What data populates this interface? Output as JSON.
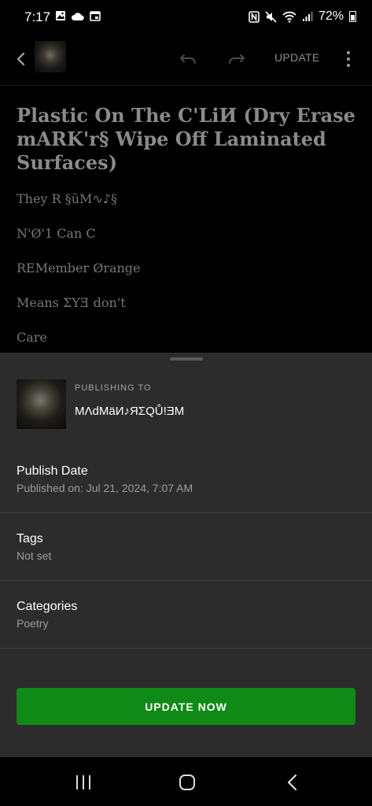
{
  "status_bar": {
    "time": "7:17",
    "battery": "72%",
    "left_icons": [
      "image-icon",
      "cloud-icon",
      "calendar-icon"
    ],
    "right_icons": [
      "nfc-icon",
      "mute-icon",
      "wifi-icon",
      "signal-icon",
      "battery-icon"
    ]
  },
  "app_bar": {
    "update_label": "UPDATE",
    "icons": [
      "back-icon",
      "undo-icon",
      "redo-icon",
      "more-vert-icon"
    ]
  },
  "post": {
    "title": "Plastic On The C'LiИ (Dry Erase mARK'r§ Wipe Off Laminated Surfaces)",
    "lines": [
      "They R §üM∿♪§",
      "N'Ø'1 Can C",
      "REMember Ørange",
      "Means ΣYƎ don't",
      "Care"
    ]
  },
  "sheet": {
    "publishing_to_label": "PUBLISHING TO",
    "site_name": "MΛdMäИ♪ЯΣQŮ!ƎM",
    "publish_date": {
      "title": "Publish Date",
      "value": "Published on: Jul 21, 2024, 7:07 AM"
    },
    "tags": {
      "title": "Tags",
      "value": "Not set"
    },
    "categories": {
      "title": "Categories",
      "value": "Poetry"
    },
    "update_now_label": "UPDATE NOW"
  },
  "colors": {
    "accent_green": "#0f8a16",
    "sheet_background": "#2c2c2c",
    "page_background": "#000000"
  },
  "nav_bar": {
    "icons": [
      "recents-icon",
      "home-icon",
      "back-nav-icon"
    ]
  }
}
